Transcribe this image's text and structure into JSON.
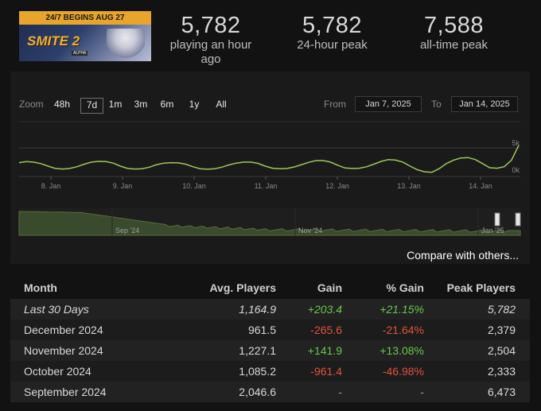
{
  "banner": {
    "strip_text": "24/7 BEGINS AUG 27",
    "logo_text": "SMITE 2",
    "logo_sub": "ALPHA"
  },
  "stats": [
    {
      "value": "5,782",
      "label": "playing an hour ago"
    },
    {
      "value": "5,782",
      "label": "24-hour peak"
    },
    {
      "value": "7,588",
      "label": "all-time peak"
    }
  ],
  "zoom": {
    "label": "Zoom",
    "options": [
      "48h",
      "7d",
      "1m",
      "3m",
      "6m",
      "1y",
      "All"
    ],
    "selected": "7d"
  },
  "date_range": {
    "from_label": "From",
    "from_value": "Jan 7, 2025",
    "to_label": "To",
    "to_value": "Jan 14, 2025"
  },
  "chart_data": {
    "type": "line",
    "x_ticks": [
      "8. Jan",
      "9. Jan",
      "10. Jan",
      "11. Jan",
      "12. Jan",
      "13. Jan",
      "14. Jan"
    ],
    "y_ticks": [
      "5k",
      "0k"
    ],
    "ylim": [
      0,
      5000
    ],
    "series": [
      {
        "values": [
          2100,
          2300,
          2200,
          1900,
          1400,
          950,
          850,
          950,
          1300,
          1800,
          2200,
          2350,
          2300,
          2000,
          1400,
          950,
          850,
          900,
          1200,
          1700,
          2000,
          2100,
          2050,
          1800,
          1300,
          900,
          800,
          900,
          1200,
          1650,
          2000,
          2200,
          2200,
          1950,
          1400,
          1000,
          900,
          950,
          1250,
          1700,
          2150,
          2500,
          2500,
          2200,
          1600,
          1050,
          950,
          1000,
          1300,
          1800,
          2350,
          2700,
          2600,
          2200,
          1400,
          700,
          300,
          200,
          900,
          1900,
          2600,
          3000,
          3100,
          2700,
          1900,
          1100,
          1000,
          1300,
          2600,
          5500
        ]
      }
    ],
    "line_color": "#9cc85a"
  },
  "navigator": {
    "labels": [
      "Sep '24",
      "Nov '24",
      "Jan '25"
    ],
    "area_color": "#3a4a2c"
  },
  "compare_link": "Compare with others...",
  "table": {
    "headers": [
      "Month",
      "Avg. Players",
      "Gain",
      "% Gain",
      "Peak Players"
    ],
    "rows": [
      {
        "month": "Last 30 Days",
        "avg": "1,164.9",
        "gain": "+203.4",
        "pgain": "+21.15%",
        "peak": "5,782",
        "trend": "pos",
        "italic": true
      },
      {
        "month": "December 2024",
        "avg": "961.5",
        "gain": "-265.6",
        "pgain": "-21.64%",
        "peak": "2,379",
        "trend": "neg",
        "italic": false
      },
      {
        "month": "November 2024",
        "avg": "1,227.1",
        "gain": "+141.9",
        "pgain": "+13.08%",
        "peak": "2,504",
        "trend": "pos",
        "italic": false
      },
      {
        "month": "October 2024",
        "avg": "1,085.2",
        "gain": "-961.4",
        "pgain": "-46.98%",
        "peak": "2,333",
        "trend": "neg",
        "italic": false
      },
      {
        "month": "September 2024",
        "avg": "2,046.6",
        "gain": "-",
        "pgain": "-",
        "peak": "6,473",
        "trend": "none",
        "italic": false
      }
    ]
  }
}
